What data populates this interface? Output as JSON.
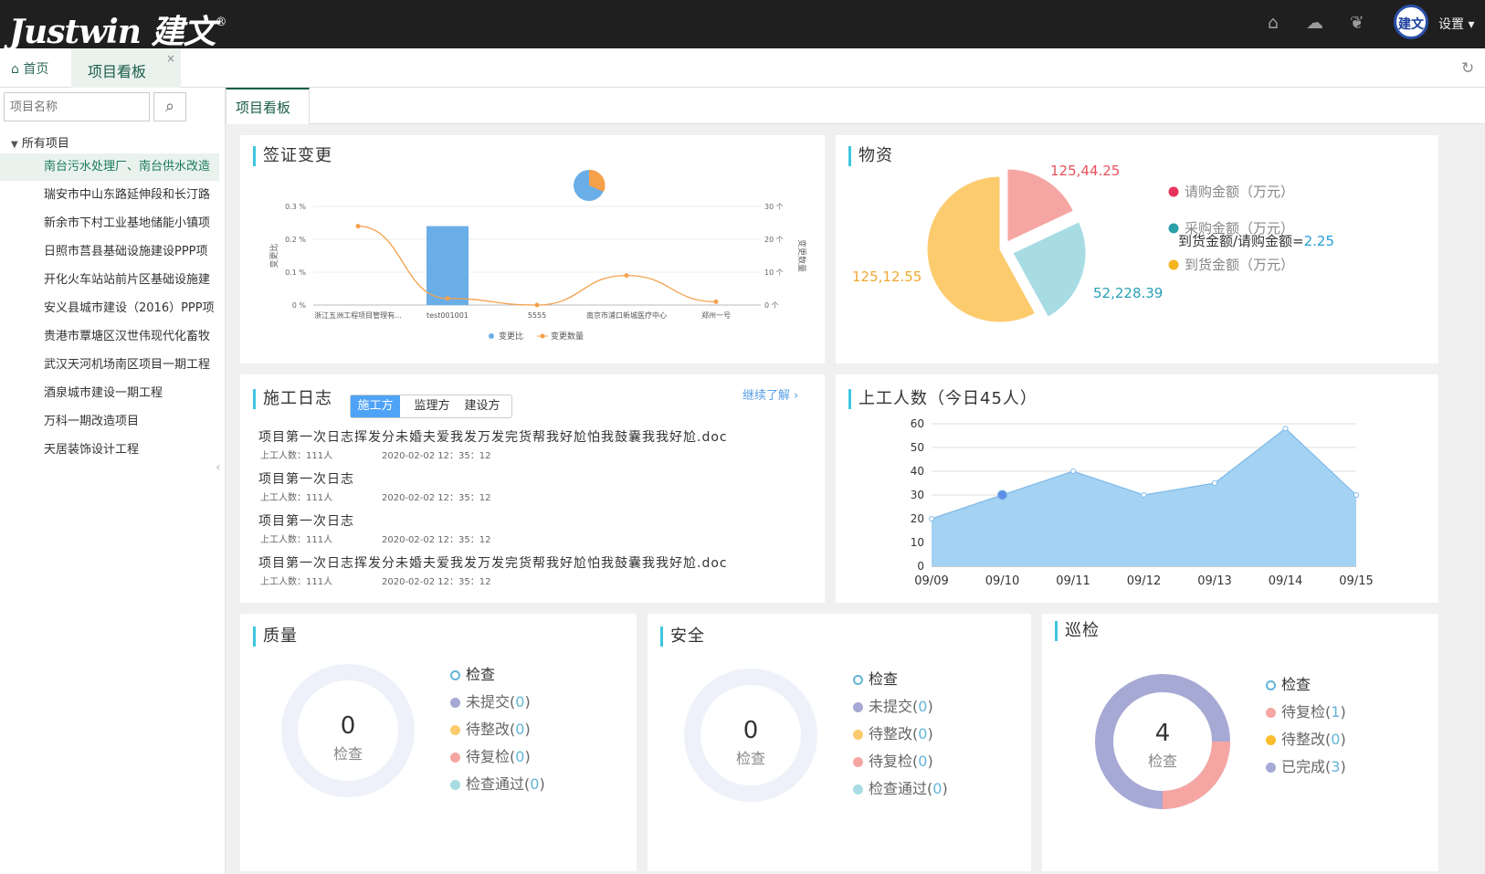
{
  "header": {
    "brand": "Justwin 建文",
    "trademark": "®",
    "avatar_text": "建文",
    "settings_label": "设置",
    "icons": [
      "home-icon",
      "wechat-icon",
      "leaf-icon"
    ]
  },
  "tabs": {
    "home_label": "首页",
    "active_label": "项目看板",
    "close": "×"
  },
  "sidebar": {
    "search_placeholder": "项目名称",
    "root_label": "所有项目",
    "items": [
      "南台污水处理厂、南台供水改造",
      "瑞安市中山东路延伸段和长汀路",
      "新余市下村工业基地储能小镇项",
      "日照市莒县基础设施建设PPP项",
      "开化火车站站前片区基础设施建",
      "安义县城市建设（2016）PPP项",
      "贵港市覃塘区汉世伟现代化畜牧",
      "武汉天河机场南区项目一期工程",
      "酒泉城市建设一期工程",
      "万科一期改造项目",
      "天居装饰设计工程"
    ]
  },
  "subtab": "项目看板",
  "visa": {
    "title": "签证变更",
    "y_left_ticks": [
      "0.3 %",
      "0.2 %",
      "0.1 %",
      "0 %"
    ],
    "y_right_ticks": [
      "30 个",
      "20 个",
      "10 个",
      "0 个"
    ],
    "y_left_label": "变更比",
    "y_right_label": "变更数量",
    "legend": [
      "变更比",
      "变更数量"
    ],
    "chart_data": {
      "type": "bar",
      "categories": [
        "浙江五洲工程项目管理有...",
        "test001001",
        "5555",
        "南京市浦口新城医疗中心",
        "郑州一号"
      ],
      "series": [
        {
          "name": "变更比",
          "values": [
            0,
            0.24,
            0,
            0,
            0
          ]
        },
        {
          "name": "变更数量",
          "values": [
            24,
            2,
            0,
            9,
            1
          ]
        }
      ],
      "ylim_left": [
        0,
        0.3
      ],
      "ylim_right": [
        0,
        30
      ]
    }
  },
  "materials": {
    "title": "物资",
    "labels": [
      "125,44.25",
      "52,228.39",
      "125,12.55"
    ],
    "legend": [
      "请购金额（万元）",
      "采购金额（万元）",
      "到货金额（万元）"
    ],
    "ratio_label": "到货金额/请购金额=",
    "ratio_value": "2.25",
    "colors": [
      "#f6a6a2",
      "#a7dce3",
      "#fbcb6e"
    ],
    "chart_data": {
      "type": "pie",
      "values": [
        0.18,
        0.24,
        0.58
      ]
    }
  },
  "log": {
    "title": "施工日志",
    "tabs": [
      "施工方",
      "监理方",
      "建设方"
    ],
    "more": "继续了解",
    "entries": [
      {
        "title": "项目第一次日志挥发分未婚夫爱我发万发完货帮我好尬怕我鼓囊我我好尬.doc",
        "workers": "上工人数：111人",
        "time": "2020-02-02 12：35：12"
      },
      {
        "title": "项目第一次日志",
        "workers": "上工人数：111人",
        "time": "2020-02-02 12：35：12"
      },
      {
        "title": "项目第一次日志",
        "workers": "上工人数：111人",
        "time": "2020-02-02 12：35：12"
      },
      {
        "title": "项目第一次日志挥发分未婚夫爱我发万发完货帮我好尬怕我鼓囊我我好尬.doc",
        "workers": "上工人数：111人",
        "time": "2020-02-02 12：35：12"
      }
    ]
  },
  "workers": {
    "title": "上工人数（今日45人）",
    "y_ticks": [
      "60",
      "50",
      "40",
      "30",
      "20",
      "10",
      "0"
    ],
    "chart_data": {
      "type": "area",
      "x": [
        "09/09",
        "09/10",
        "09/11",
        "09/12",
        "09/13",
        "09/14",
        "09/15"
      ],
      "values": [
        20,
        30,
        40,
        30,
        35,
        58,
        30
      ],
      "ylim": [
        0,
        60
      ]
    }
  },
  "quality": {
    "title": "质量",
    "count": "0",
    "center_label": "检查",
    "legend_title": "检查",
    "items": [
      {
        "label": "未提交",
        "count": "0",
        "color": "#a6a9d4"
      },
      {
        "label": "待整改",
        "count": "0",
        "color": "#fbcb6e"
      },
      {
        "label": "待复检",
        "count": "0",
        "color": "#f6a6a2"
      },
      {
        "label": "检查通过",
        "count": "0",
        "color": "#a7dce3"
      }
    ]
  },
  "safety": {
    "title": "安全",
    "count": "0",
    "center_label": "检查",
    "legend_title": "检查",
    "items": [
      {
        "label": "未提交",
        "count": "0",
        "color": "#a6a9d4"
      },
      {
        "label": "待整改",
        "count": "0",
        "color": "#fbcb6e"
      },
      {
        "label": "待复检",
        "count": "0",
        "color": "#f6a6a2"
      },
      {
        "label": "检查通过",
        "count": "0",
        "color": "#a7dce3"
      }
    ]
  },
  "patrol": {
    "title": "巡检",
    "count": "4",
    "center_label": "检查",
    "legend_title": "检查",
    "items": [
      {
        "label": "待复检",
        "count": "1",
        "color": "#f6a6a2"
      },
      {
        "label": "待整改",
        "count": "0",
        "color": "#fbbd2e"
      },
      {
        "label": "已完成",
        "count": "3",
        "color": "#a6a9d4"
      }
    ],
    "chart_data": {
      "type": "pie",
      "values": [
        1,
        3
      ]
    }
  }
}
